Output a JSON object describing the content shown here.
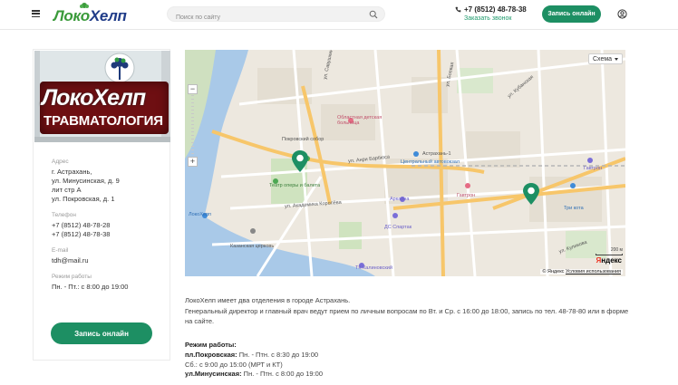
{
  "header": {
    "logo_part1": "Локо",
    "logo_part2": "Хелп",
    "search_placeholder": "Поиск по сайту",
    "phone": "+7 (8512) 48-78-38",
    "callback_label": "Заказать звонок",
    "signup_label": "Запись онлайн",
    "icons": {
      "menu": "burger-menu-icon",
      "search": "search-icon",
      "phone": "phone-icon",
      "user": "user-icon"
    }
  },
  "card": {
    "photo": {
      "logo_text": "ЛокоХелп",
      "subtitle": "ТРАВМАТОЛОГИЯ"
    },
    "address": {
      "label": "Адрес",
      "lines": [
        "г. Астрахань,",
        "ул. Минусинская, д. 9",
        "лит стр А",
        "ул. Покровская, д. 1"
      ]
    },
    "phone": {
      "label": "Телефон",
      "lines": [
        "+7 (8512) 48-78-28",
        "+7 (8512) 48-78-38"
      ]
    },
    "email": {
      "label": "E-mail",
      "value": "tdh@mail.ru"
    },
    "hours": {
      "label": "Режим работы",
      "value": "Пн. - Пт.: с 8:00 до 19:00"
    },
    "signup_label": "Запись онлайн"
  },
  "map": {
    "layer_button": "Схема",
    "zoom_in": "+",
    "zoom_out": "−",
    "scale_label": "200 м",
    "brand": {
      "part1": "Я",
      "part2": "ндекс"
    },
    "copyright": "© Яндекс",
    "terms": "Условия использования",
    "labels": [
      "Областная детская больница",
      "Покровский собор",
      "Театр оперы и балета",
      "Центральный автовокзал",
      "Астрахань-1",
      "ул. Анри Барбюса",
      "Аркарна",
      "Гавтрон",
      "ул. Академика Королёва",
      "Три кота",
      "ЛокоХелп",
      "Казанская церковь",
      "ДС Спартак",
      "ТК Калиновский",
      "ул. Савушкина",
      "ул. Боевая",
      "ул. Кубанская",
      "ул. Куликова",
      "Гавтрон"
    ]
  },
  "description": {
    "line1": "ЛокоХелп имеет два отделения в городе Астрахань.",
    "line2": "Генеральный директор и главный врач ведут прием по личным вопросам по Вт. и Ср. с 16:00 до 18:00, запись по тел. 48-78-80 или в форме на сайте."
  },
  "schedule": {
    "title": "Режим работы:",
    "rows": [
      {
        "name": "пл.Покровская:",
        "value": "Пн. - Птн. с 8:30 до 19:00"
      },
      {
        "name": "",
        "value": "Сб.: с 9:00 до 15:00 (МРТ и КТ)"
      },
      {
        "name": "ул.Минусинская:",
        "value": "Пн. - Птн. с 8:00 до 19:00"
      }
    ]
  },
  "colors": {
    "accent": "#1d8f63",
    "logo_green": "#3a9a3a",
    "logo_blue": "#1f3b88",
    "photo_red": "#6e0f12",
    "pin": "#1d8f63"
  }
}
